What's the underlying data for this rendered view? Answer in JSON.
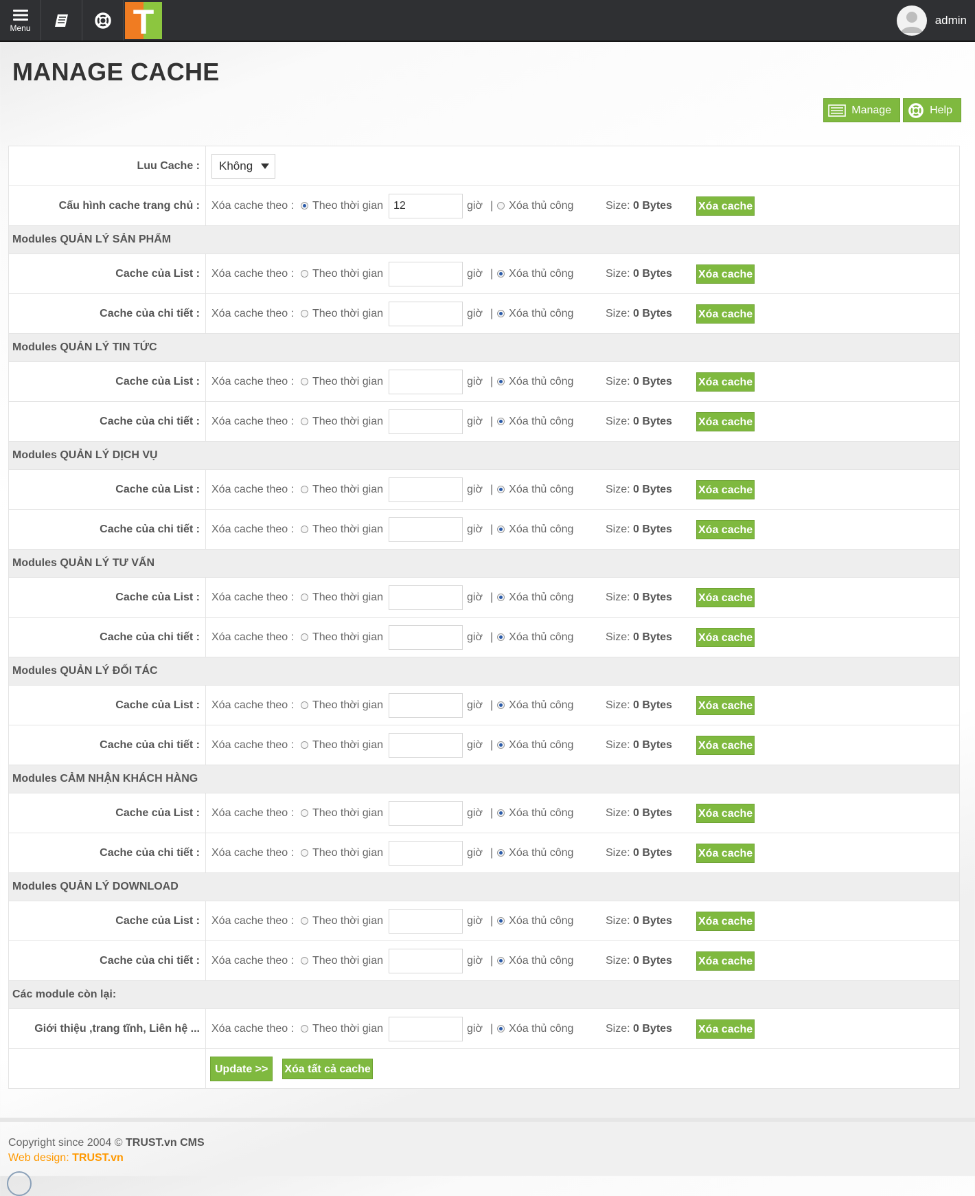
{
  "topbar": {
    "menu_label": "Menu",
    "menu_icon": "hamburger-icon",
    "book_icon": "book-icon",
    "help_icon": "lifebuoy-icon",
    "logo_letter": "T",
    "user_name": "admin"
  },
  "page_title": "MANAGE CACHE",
  "header_actions": {
    "manage": "Manage",
    "help": "Help"
  },
  "labels": {
    "xoa_theo": "Xóa cache theo :",
    "theo_thoi_gian": "Theo thời gian",
    "gio": "giờ",
    "separator": "|",
    "xoa_thu_cong": "Xóa thủ công",
    "size_label": "Size:",
    "size_value": "0 Bytes",
    "xoa_cache": "Xóa cache"
  },
  "luu_cache": {
    "label": "Luu Cache :",
    "value": "Không"
  },
  "homepage": {
    "label": "Cấu hình cache trang chủ :",
    "hours": "12"
  },
  "sections": [
    {
      "title": "Modules QUẢN LÝ SẢN PHẨM",
      "rows": [
        "Cache của List :",
        "Cache của chi tiết :"
      ]
    },
    {
      "title": "Modules QUẢN LÝ TIN TỨC",
      "rows": [
        "Cache của List :",
        "Cache của chi tiết :"
      ]
    },
    {
      "title": "Modules QUẢN LÝ DỊCH VỤ",
      "rows": [
        "Cache của List :",
        "Cache của chi tiết :"
      ]
    },
    {
      "title": "Modules QUẢN LÝ TƯ VẤN",
      "rows": [
        "Cache của List :",
        "Cache của chi tiết :"
      ]
    },
    {
      "title": "Modules QUẢN LÝ ĐỐI TÁC",
      "rows": [
        "Cache của List :",
        "Cache của chi tiết :"
      ]
    },
    {
      "title": "Modules CẢM NHẬN KHÁCH HÀNG",
      "rows": [
        "Cache của List :",
        "Cache của chi tiết :"
      ]
    },
    {
      "title": "Modules QUẢN LÝ DOWNLOAD",
      "rows": [
        "Cache của List :",
        "Cache của chi tiết :"
      ]
    },
    {
      "title": "Các module còn lại:",
      "rows": [
        "Giới thiệu ,trang tĩnh, Liên hệ ..."
      ]
    }
  ],
  "form_actions": {
    "update": "Update >>",
    "clear_all": "Xóa tất cả cache"
  },
  "footer": {
    "copyright_prefix": "Copyright since 2004 ©",
    "copyright_brand": "TRUST.vn CMS",
    "webdesign_prefix": "Web design:",
    "webdesign_brand": "TRUST.vn"
  },
  "colors": {
    "accent_green": "#7fb93f",
    "topbar": "#2f3033",
    "logo_orange": "#f07c22",
    "logo_green": "#8cc63f",
    "footer_orange": "#ff9900"
  }
}
